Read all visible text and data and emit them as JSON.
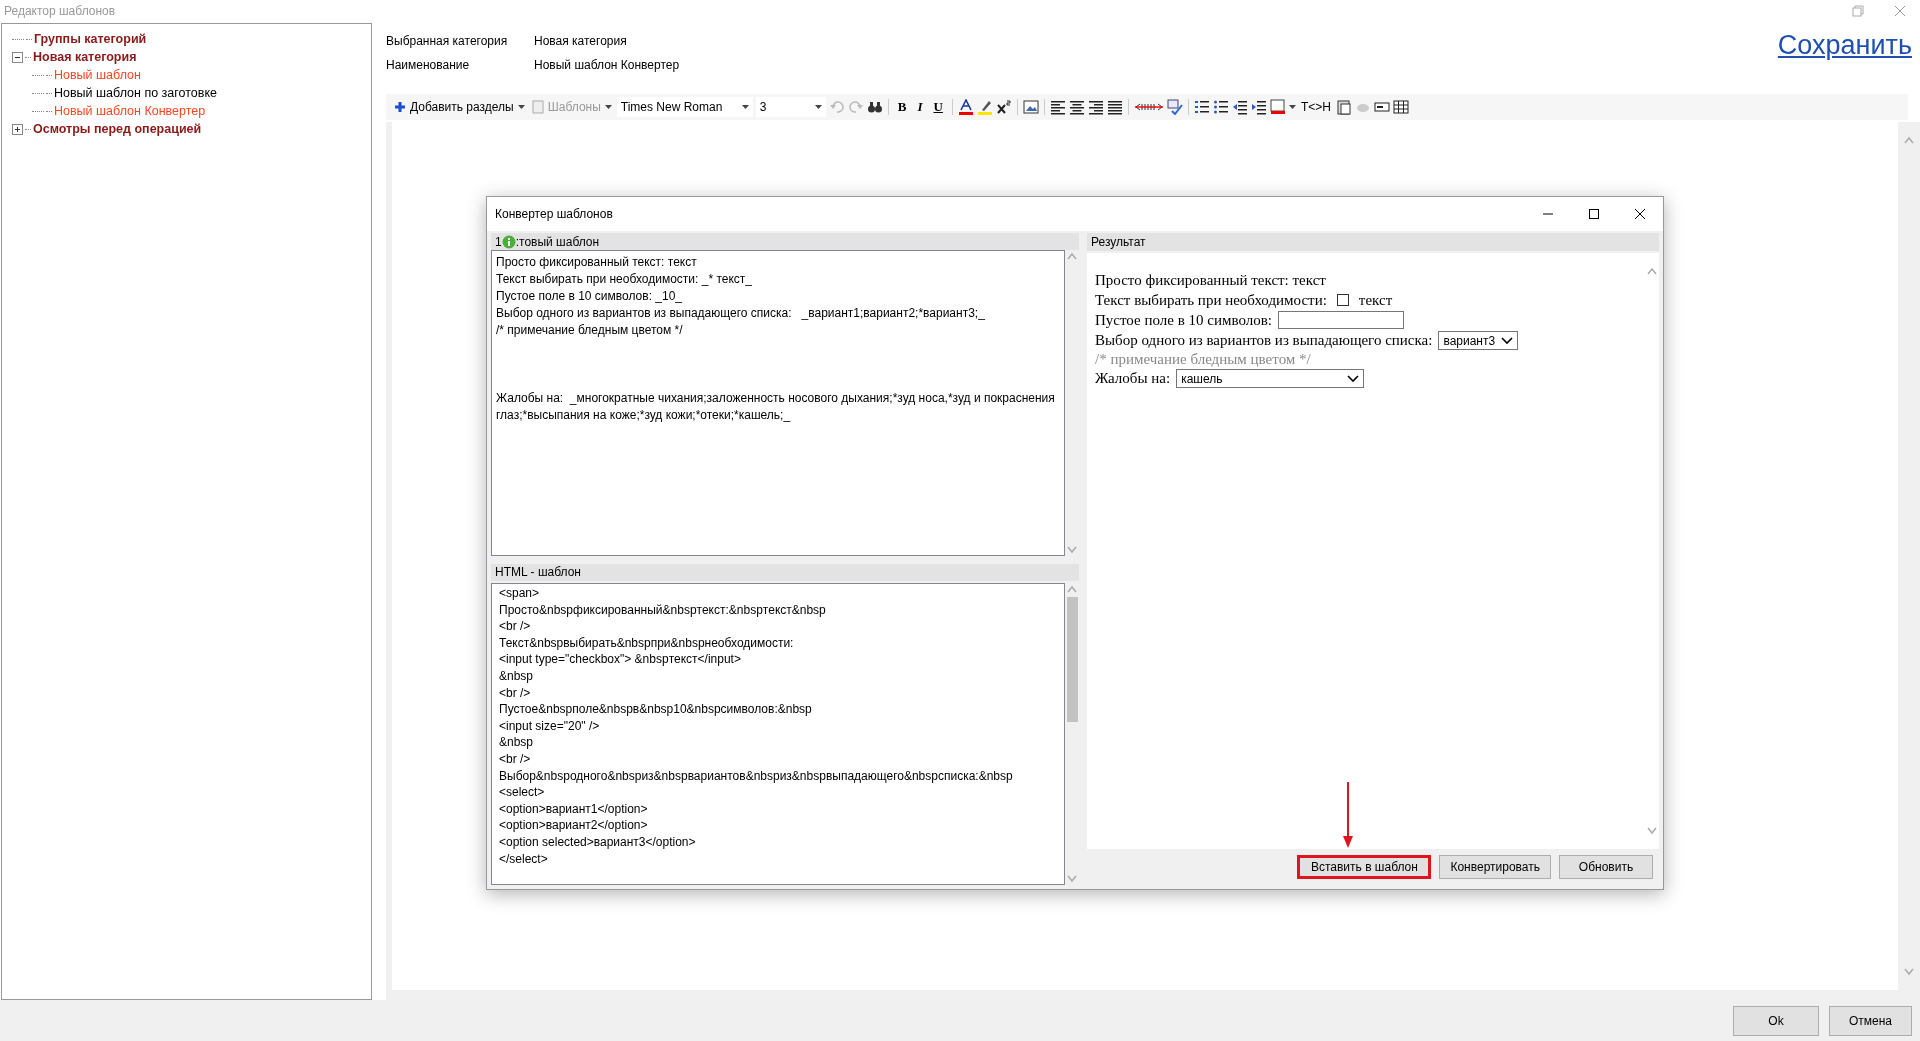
{
  "window": {
    "title": "Редактор шаблонов"
  },
  "tree": [
    {
      "label": "Группы категорий",
      "color": "#8b1a1a",
      "group": true
    },
    {
      "label": "Новая категория",
      "color": "#8b1a1a",
      "group": true,
      "expanded": true,
      "children": [
        {
          "label": "Новый шаблон",
          "color": "#ff4422"
        },
        {
          "label": "Новый шаблон по заготовке",
          "color": "#000000"
        },
        {
          "label": "Новый шаблон Конвертер",
          "color": "#ff4422"
        }
      ]
    },
    {
      "label": "Осмотры перед операцией",
      "color": "#8b1a1a",
      "group": true,
      "expanded": false
    }
  ],
  "header": {
    "fields": [
      {
        "label": "Выбранная категория",
        "value": "Новая категория"
      },
      {
        "label": "Наименование",
        "value": "Новый шаблон Конвертер"
      }
    ],
    "save_link": "Сохранить"
  },
  "toolbar": {
    "add_sections": "Добавить разделы",
    "templates": {
      "label": "Шаблоны",
      "disabled": true
    },
    "font": "Times New Roman",
    "size": "3",
    "undo_disabled": true,
    "redo_disabled": true,
    "bold": "B",
    "italic": "I",
    "underline": "U",
    "tag_toggle": "T<>H"
  },
  "dialog": {
    "title": "Конвертер шаблонов",
    "source": {
      "header_start": "1",
      "header_end": ":товый шаблон",
      "lines": [
        "Просто фиксированный текст: текст",
        "Текст выбирать при необходимости: _* текст_",
        "Пустое поле в 10 символов: _10_",
        "Выбор одного из вариантов из выпадающего списка:   _вариант1;вариант2;*вариант3;_",
        "/* примечание бледным цветом */"
      ],
      "complaints_line": "Жалобы на:  _многократные чихания;заложенность носового дыхания;*зуд носа,*зуд и покраснения глаз;*высыпания на коже;*зуд кожи;*отеки;*кашель;_"
    },
    "html": {
      "header": "HTML - шаблон",
      "lines": [
        "<span>",
        "Просто&nbspфиксированный&nbspтекст:&nbspтекст&nbsp",
        "<br />",
        "Текст&nbspвыбирать&nbspпри&nbspнеобходимости:",
        "<input type=\"checkbox\"> &nbspтекст</input>",
        "&nbsp",
        "<br />",
        "Пустое&nbspполе&nbspв&nbsp10&nbspсимволов:&nbsp",
        "<input size=\"20\" />",
        "&nbsp",
        "<br />",
        "Выбор&nbspодного&nbspиз&nbspвариантов&nbspиз&nbspвыпадающего&nbspсписка:&nbsp",
        "<select>",
        "<option>вариант1</option>",
        "<option>вариант2</option>",
        "<option selected>вариант3</option>",
        "</select>"
      ]
    },
    "result": {
      "header": "Результат",
      "rows": [
        {
          "kind": "text",
          "text": "Просто фиксированный текст: текст"
        },
        {
          "kind": "checkbox",
          "text": "Текст выбирать при необходимости:",
          "checked": false,
          "after": "текст"
        },
        {
          "kind": "input",
          "text": "Пустое поле в 10 символов:"
        },
        {
          "kind": "select",
          "text": "Выбор одного из вариантов из выпадающего списка:",
          "value": "вариант3"
        },
        {
          "kind": "note",
          "text": "/* примечание бледным цветом */"
        },
        {
          "kind": "wideselect",
          "text": "Жалобы на:",
          "value": "кашель"
        }
      ]
    },
    "buttons": [
      {
        "label": "Вставить в шаблон",
        "highlighted": true
      },
      {
        "label": "Конвертировать",
        "highlighted": false
      },
      {
        "label": "Обновить",
        "highlighted": false
      }
    ]
  },
  "footer_buttons": [
    "Ok",
    "Отмена"
  ]
}
